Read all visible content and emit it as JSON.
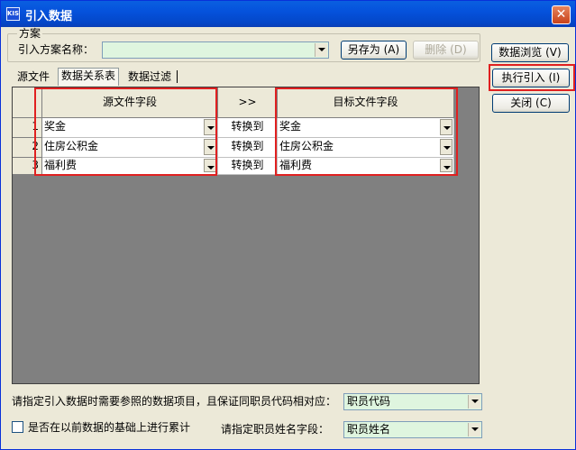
{
  "window": {
    "title": "引入数据",
    "app_icon_text": "KIS"
  },
  "scheme": {
    "group_title": "方案",
    "name_label": "引入方案名称：",
    "name_value": "",
    "save_as_label": "另存为 (A)",
    "delete_label": "删除 (D)"
  },
  "side_buttons": {
    "browse_label": "数据浏览 (V)",
    "execute_label": "执行引入 (I)",
    "close_label": "关闭 (C)"
  },
  "tabs": [
    "源文件",
    "数据关系表",
    "数据过滤"
  ],
  "active_tab": 1,
  "grid": {
    "headers": {
      "source": "源文件字段",
      "arrow": ">>",
      "target": "目标文件字段"
    },
    "rows": [
      {
        "num": "1",
        "source": "奖金",
        "action": "转换到",
        "target": "奖金"
      },
      {
        "num": "2",
        "source": "住房公积金",
        "action": "转换到",
        "target": "住房公积金"
      },
      {
        "num": "3",
        "source": "福利费",
        "action": "转换到",
        "target": "福利费"
      }
    ]
  },
  "footer": {
    "ref_item_label": "请指定引入数据时需要参照的数据项目，且保证同职员代码相对应：",
    "ref_item_value": "职员代码",
    "accumulate_label": "是否在以前数据的基础上进行累计",
    "accumulate_checked": false,
    "name_field_label": "请指定职员姓名字段：",
    "name_field_value": "职员姓名"
  },
  "colors": {
    "title_bar": "#0552dc",
    "combo_bg": "#dff5df",
    "highlight": "#e02020"
  }
}
